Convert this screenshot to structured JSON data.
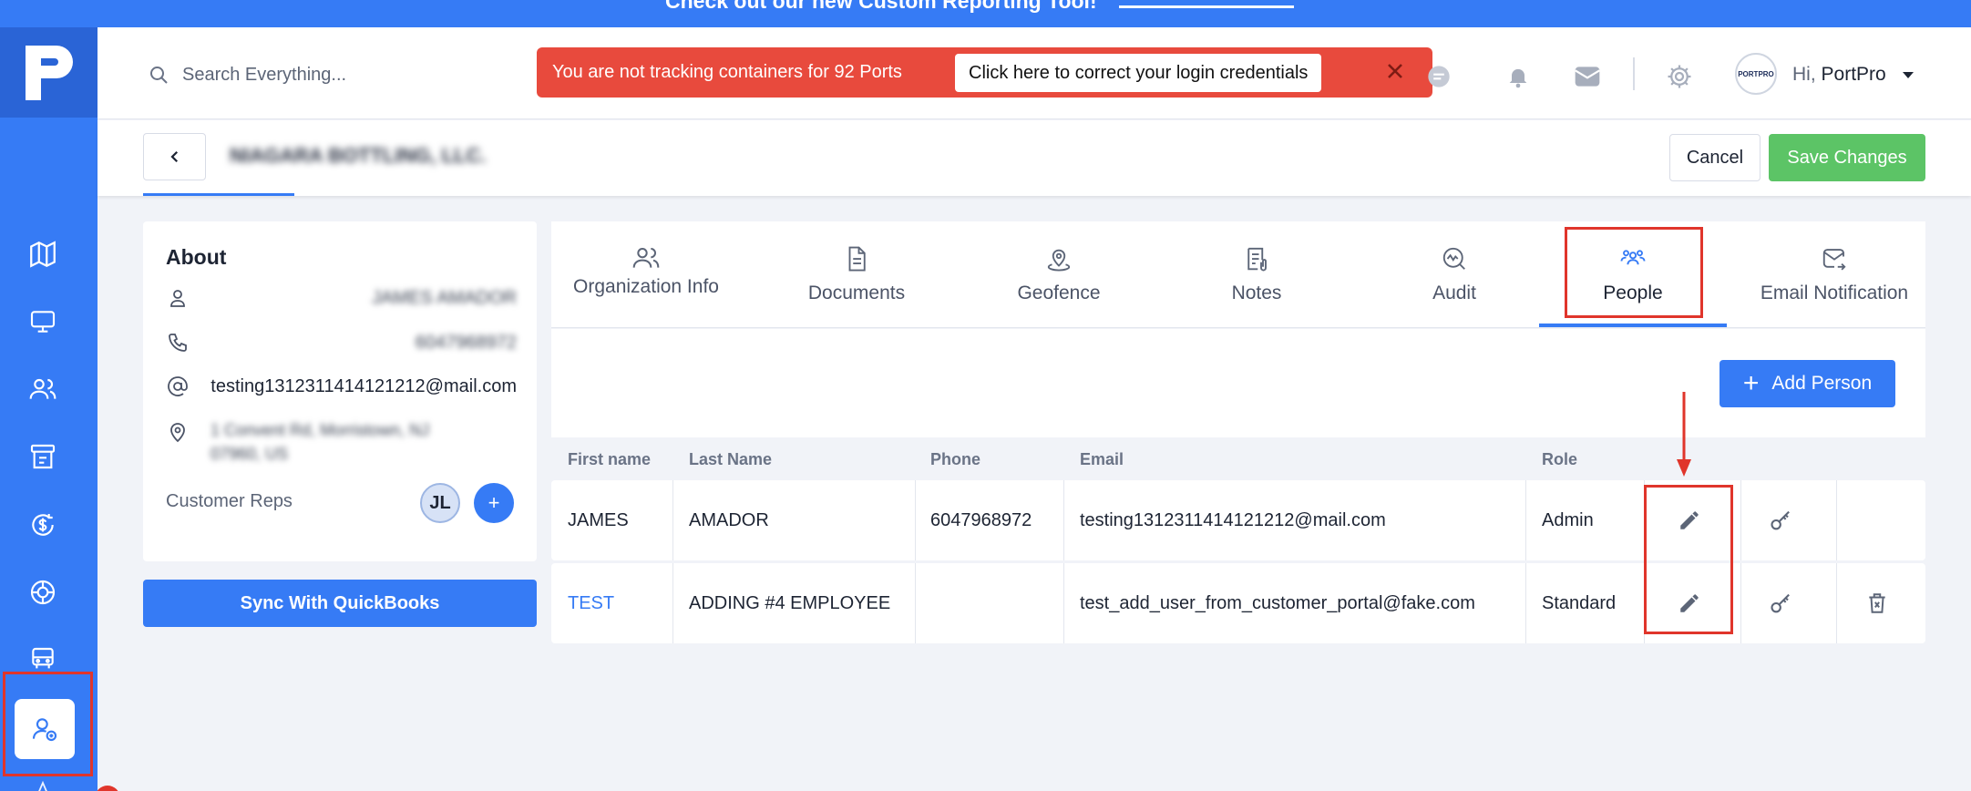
{
  "top_banner": {
    "text": "Check out our new Custom Reporting Tool!",
    "link_label": ""
  },
  "sidebar": {
    "items": [
      {
        "name": "map-icon"
      },
      {
        "name": "monitor-icon"
      },
      {
        "name": "users-icon"
      },
      {
        "name": "billing-icon"
      },
      {
        "name": "dollar-icon"
      },
      {
        "name": "tire-icon"
      },
      {
        "name": "truck-icon"
      },
      {
        "name": "customer-profile-icon",
        "active": true
      }
    ]
  },
  "header": {
    "search_placeholder": "Search Everything...",
    "alert_message": "You are not tracking containers for 92 Ports",
    "alert_button": "Click here to correct your login credentials",
    "avatar_text": "PORTPRO",
    "greeting_hi": "Hi,",
    "greeting_name": "PortPro"
  },
  "subheader": {
    "company_name": "NIAGARA BOTTLING, LLC.",
    "cancel_label": "Cancel",
    "save_label": "Save Changes"
  },
  "about": {
    "title": "About",
    "contact_name": "JAMES AMADOR",
    "phone": "6047968972",
    "email": "testing1312311414121212@mail.com",
    "address": "1 Convent Rd, Morristown, NJ 07960, US",
    "reps_label": "Customer Reps",
    "rep_initials": "JL",
    "rep_add": "+"
  },
  "sync_label": "Sync With QuickBooks",
  "tabs": [
    {
      "label": "Organization Info"
    },
    {
      "label": "Documents"
    },
    {
      "label": "Geofence"
    },
    {
      "label": "Notes"
    },
    {
      "label": "Audit"
    },
    {
      "label": "People",
      "active": true
    },
    {
      "label": "Email Notification"
    }
  ],
  "people": {
    "add_label": "Add Person",
    "add_plus": "+",
    "columns": [
      "First name",
      "Last Name",
      "Phone",
      "Email",
      "Role"
    ],
    "rows": [
      {
        "first": "JAMES",
        "last": "AMADOR",
        "phone": "6047968972",
        "email": "testing1312311414121212@mail.com",
        "role": "Admin"
      },
      {
        "first": "TEST",
        "last": "ADDING #4 EMPLOYEE",
        "phone": "",
        "email": "test_add_user_from_customer_portal@fake.com",
        "role": "Standard"
      }
    ]
  },
  "colors": {
    "primary": "#367bf5",
    "success": "#5cc466",
    "alert": "#e84a3d",
    "annotation": "#e0352b"
  }
}
